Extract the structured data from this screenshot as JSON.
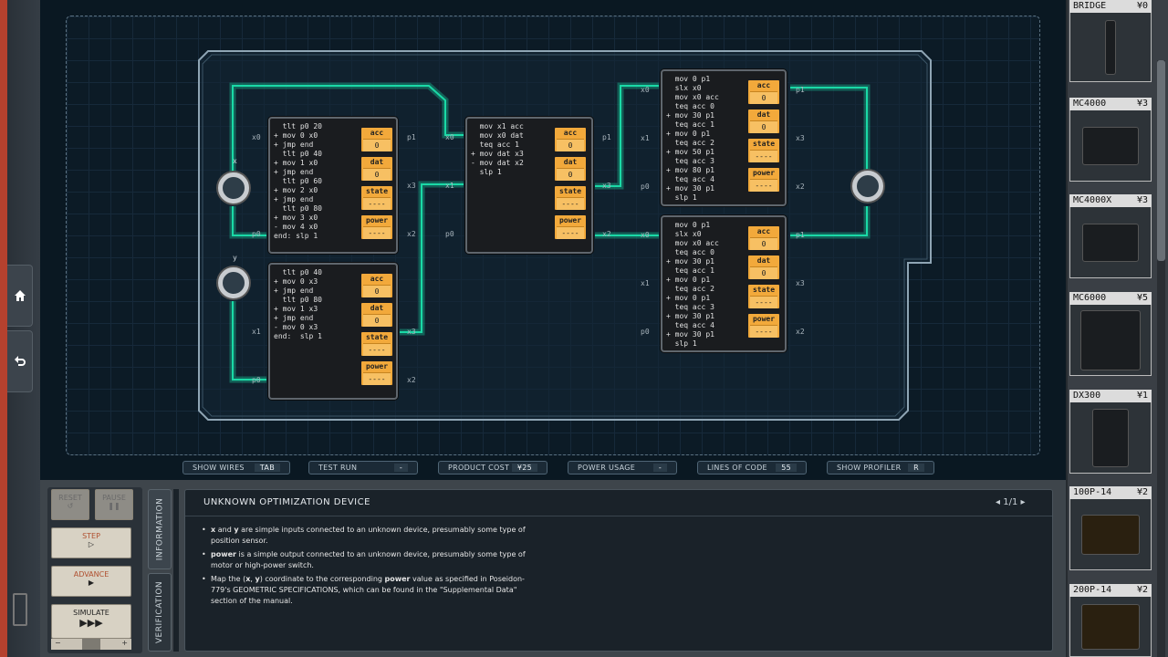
{
  "palette": [
    {
      "name": "BRIDGE",
      "price": "¥0"
    },
    {
      "name": "MC4000",
      "price": "¥3"
    },
    {
      "name": "MC4000X",
      "price": "¥3"
    },
    {
      "name": "MC6000",
      "price": "¥5"
    },
    {
      "name": "DX300",
      "price": "¥1"
    },
    {
      "name": "100P-14",
      "price": "¥2"
    },
    {
      "name": "200P-14",
      "price": "¥2"
    }
  ],
  "io": {
    "x_label": "x",
    "y_label": "y"
  },
  "chips": {
    "c1": {
      "code": "  tlt p0 20\n+ mov 0 x0\n+ jmp end\n  tlt p0 40\n+ mov 1 x0\n+ jmp end\n  tlt p0 60\n+ mov 2 x0\n+ jmp end\n  tlt p0 80\n+ mov 3 x0\n- mov 4 x0\nend: slp 1",
      "acc": "0",
      "dat": "0",
      "state": "----",
      "power": "----"
    },
    "c2": {
      "code": "  tlt p0 40\n+ mov 0 x3\n+ jmp end\n  tlt p0 80\n+ mov 1 x3\n+ jmp end\n- mov 0 x3\nend:  slp 1",
      "acc": "0",
      "dat": "0",
      "state": "----",
      "power": "----"
    },
    "c3": {
      "code": "  mov x1 acc\n  mov x0 dat\n  teq acc 1\n+ mov dat x3\n- mov dat x2\n  slp 1",
      "acc": "0",
      "dat": "0",
      "state": "----",
      "power": "----"
    },
    "c4": {
      "code": "  mov 0 p1\n  slx x0\n  mov x0 acc\n  teq acc 0\n+ mov 30 p1\n  teq acc 1\n+ mov 0 p1\n  teq acc 2\n+ mov 50 p1\n  teq acc 3\n+ mov 80 p1\n  teq acc 4\n+ mov 30 p1\n  slp 1",
      "acc": "0",
      "dat": "0",
      "state": "----",
      "power": "----"
    },
    "c5": {
      "code": "  mov 0 p1\n  slx x0\n  mov x0 acc\n  teq acc 0\n+ mov 30 p1\n  teq acc 1\n+ mov 0 p1\n  teq acc 2\n+ mov 0 p1\n  teq acc 3\n+ mov 30 p1\n  teq acc 4\n+ mov 30 p1\n  slp 1",
      "acc": "0",
      "dat": "0",
      "state": "----",
      "power": "----"
    }
  },
  "reg_labels": {
    "acc": "acc",
    "dat": "dat",
    "state": "state",
    "power": "power"
  },
  "pins": {
    "x0": "x0",
    "x1": "x1",
    "x2": "x2",
    "x3": "x3",
    "p0": "p0",
    "p1": "p1"
  },
  "status": {
    "show_wires": "SHOW WIRES",
    "show_wires_key": "TAB",
    "test_run": "TEST RUN",
    "test_run_val": "-",
    "product_cost": "PRODUCT COST",
    "product_cost_val": "¥25",
    "power_usage": "POWER USAGE",
    "power_usage_val": "-",
    "lines_of_code": "LINES OF CODE",
    "lines_of_code_val": "55",
    "show_profiler": "SHOW PROFILER",
    "show_profiler_key": "R"
  },
  "controls": {
    "reset": "RESET",
    "pause": "PAUSE",
    "step": "STEP",
    "advance": "ADVANCE",
    "simulate": "SIMULATE",
    "minus": "−",
    "plus": "+"
  },
  "tabs": {
    "information": "INFORMATION",
    "verification": "VERIFICATION"
  },
  "info": {
    "title": "UNKNOWN OPTIMIZATION DEVICE",
    "page": "1/1",
    "b1_strong1": "x",
    "b1_and": " and ",
    "b1_strong2": "y",
    "b1_rest": " are simple inputs connected to an unknown device, presumably some type of position sensor.",
    "b2_strong": "power",
    "b2_rest": " is a simple output connected to an unknown device, presumably some type of motor or high-power switch.",
    "b3_a": "Map the (",
    "b3_x": "x",
    "b3_comma": ", ",
    "b3_y": "y",
    "b3_b": ") coordinate to the corresponding ",
    "b3_power": "power",
    "b3_c": " value as specified in Poseidon-779's GEOMETRIC SPECIFICATIONS, which can be found in the \"Supplemental Data\" section of the manual."
  },
  "colors": {
    "accent": "#f2a93b",
    "wire": "#1ad9a6",
    "board": "#0c1b26"
  }
}
